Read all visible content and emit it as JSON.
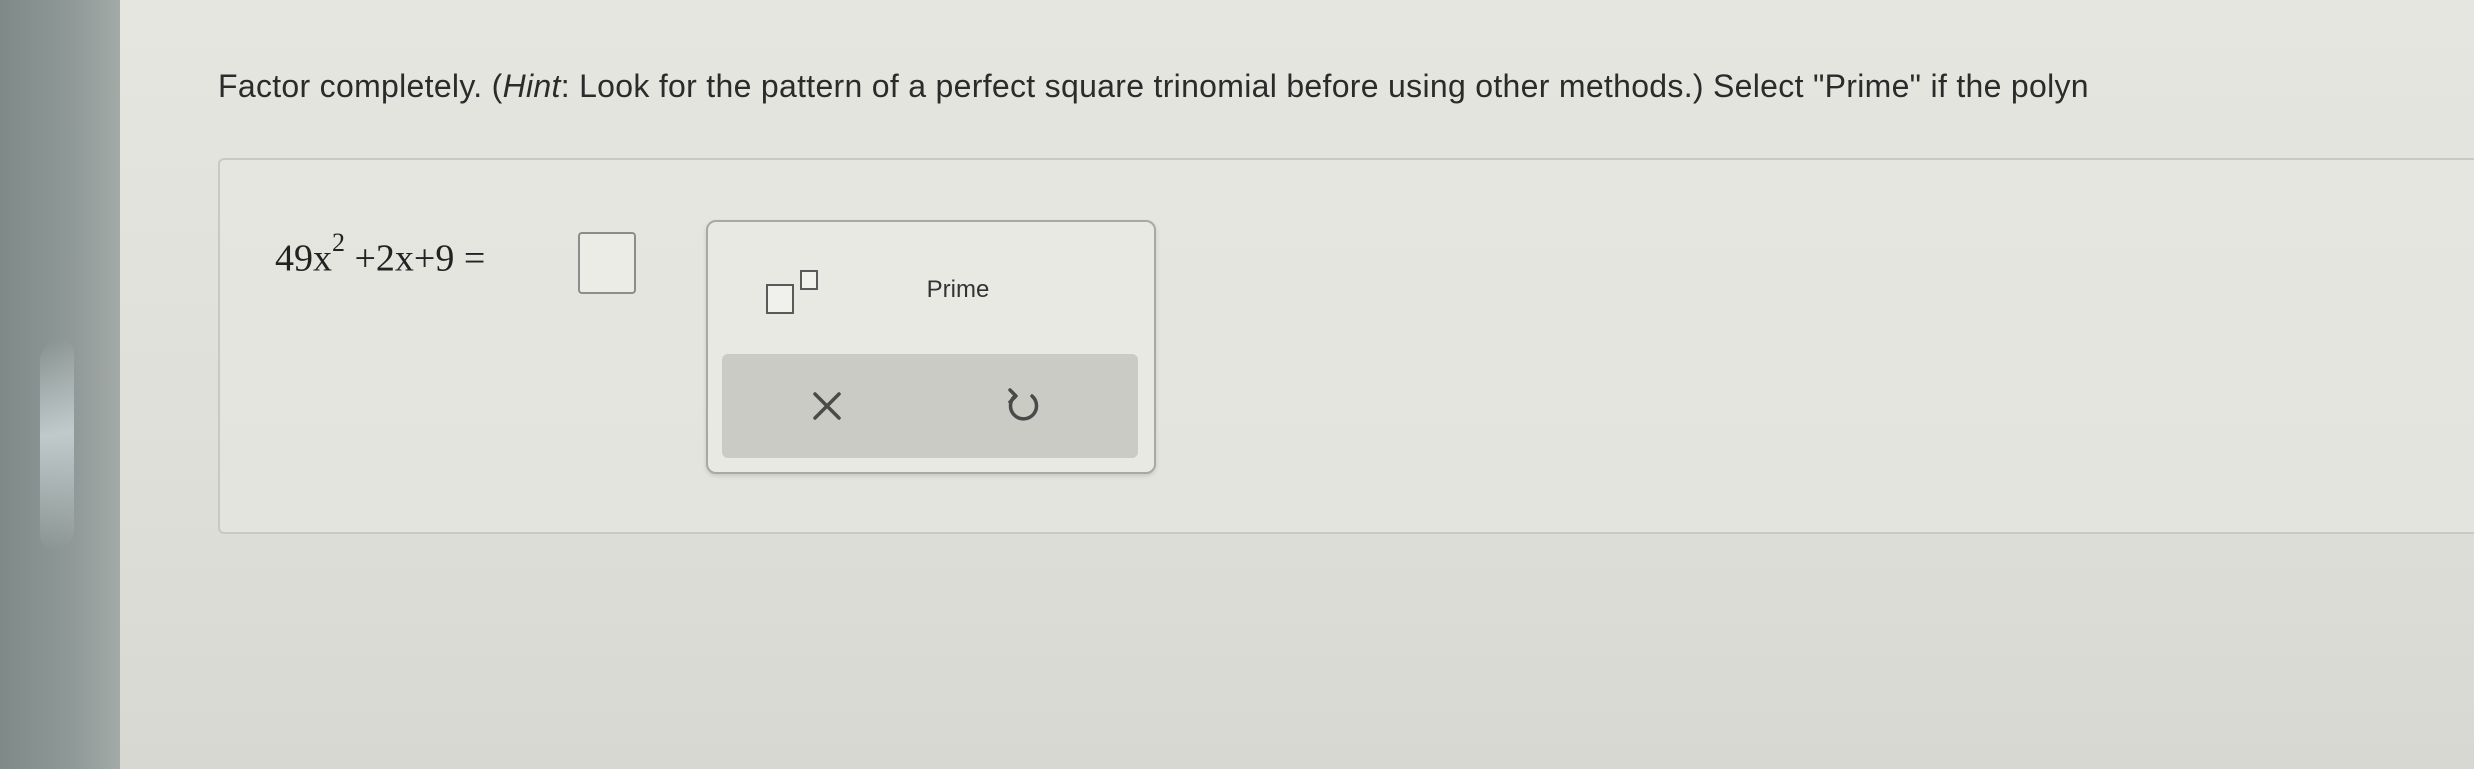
{
  "question": {
    "lead": "Factor completely. (",
    "hint_word": "Hint",
    "rest": ": Look for the pattern of a perfect square trinomial before using other methods.) Select \"Prime\" if the polyn"
  },
  "equation": {
    "coefficient_var": "49x",
    "exponent": "2",
    "remainder": " +2x+9 ="
  },
  "palette": {
    "prime_label": "Prime",
    "exponent_button_icon": "exponent-template-icon",
    "clear_icon": "close-icon",
    "undo_icon": "undo-icon"
  },
  "colors": {
    "icon": "#4a4a4a",
    "action_bar": "#cbcbc6"
  }
}
